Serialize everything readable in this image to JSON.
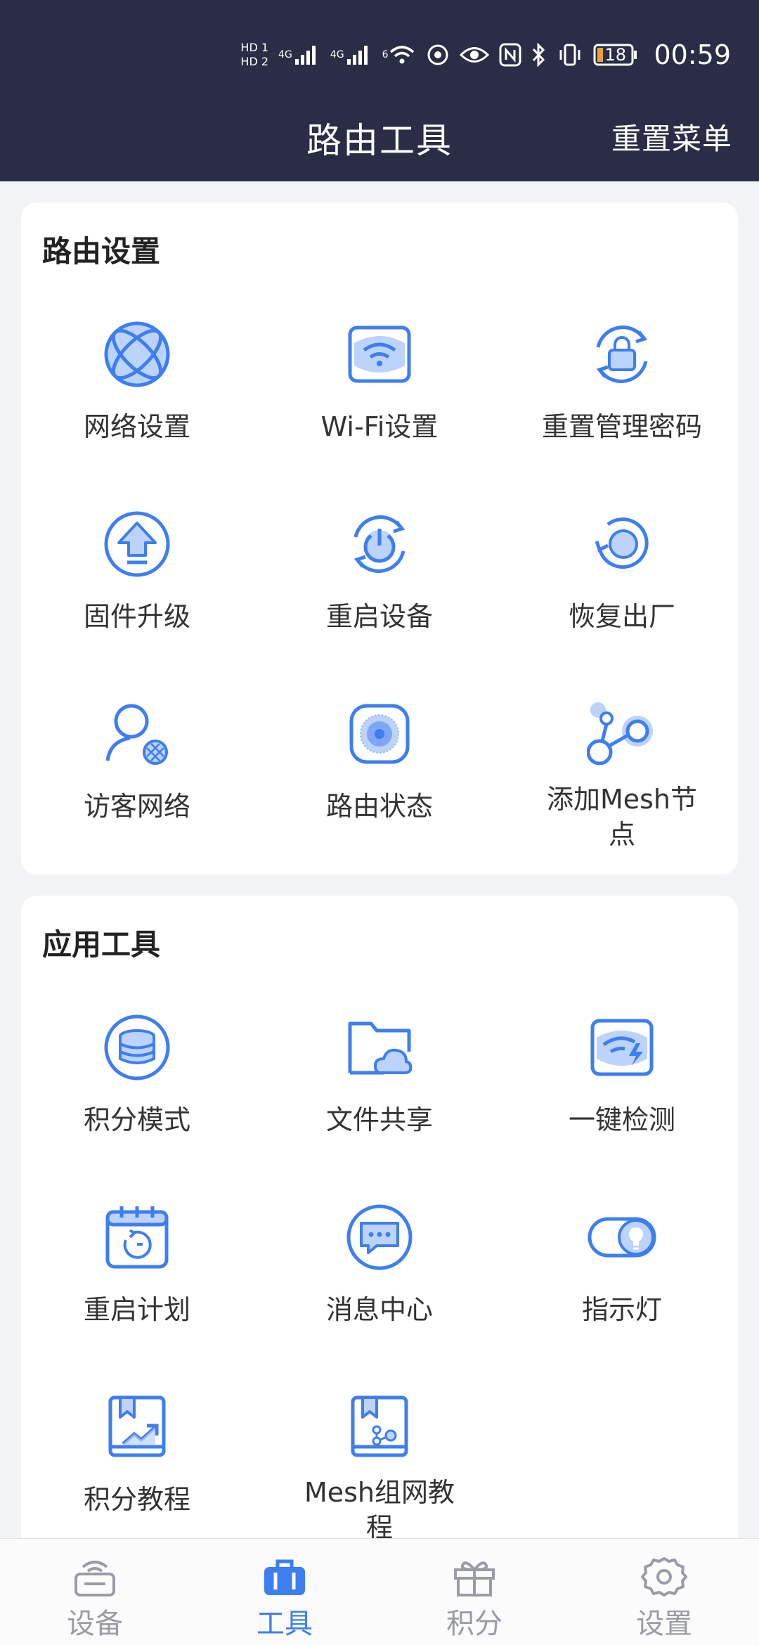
{
  "status_bar": {
    "time": "00:59",
    "battery": "18",
    "signal1": "4G",
    "signal2": "4G",
    "wifi": "6",
    "hd1": "HD 1",
    "hd2": "HD 2"
  },
  "header": {
    "title": "路由工具",
    "reset_menu": "重置菜单"
  },
  "router_section": {
    "title": "路由设置",
    "items": [
      {
        "label": "网络设置",
        "icon": "globe-icon"
      },
      {
        "label": "Wi-Fi设置",
        "icon": "wifi-icon"
      },
      {
        "label": "重置管理密码",
        "icon": "lock-reset-icon"
      },
      {
        "label": "固件升级",
        "icon": "upload-icon"
      },
      {
        "label": "重启设备",
        "icon": "power-icon"
      },
      {
        "label": "恢复出厂",
        "icon": "restore-icon"
      },
      {
        "label": "访客网络",
        "icon": "guest-icon"
      },
      {
        "label": "路由状态",
        "icon": "router-status-icon"
      },
      {
        "label": "添加Mesh节点",
        "icon": "mesh-node-icon"
      }
    ]
  },
  "app_section": {
    "title": "应用工具",
    "items": [
      {
        "label": "积分模式",
        "icon": "database-icon"
      },
      {
        "label": "文件共享",
        "icon": "folder-cloud-icon"
      },
      {
        "label": "一键检测",
        "icon": "wifi-check-icon"
      },
      {
        "label": "重启计划",
        "icon": "calendar-icon"
      },
      {
        "label": "消息中心",
        "icon": "message-icon"
      },
      {
        "label": "指示灯",
        "icon": "light-toggle-icon"
      },
      {
        "label": "积分教程",
        "icon": "book-chart-icon"
      },
      {
        "label": "Mesh组网教程",
        "icon": "book-mesh-icon"
      }
    ]
  },
  "bottom_nav": [
    {
      "label": "设备",
      "icon": "router-icon",
      "active": false
    },
    {
      "label": "工具",
      "icon": "toolbox-icon",
      "active": true
    },
    {
      "label": "积分",
      "icon": "gift-icon",
      "active": false
    },
    {
      "label": "设置",
      "icon": "gear-icon",
      "active": false
    }
  ],
  "colors": {
    "header_bg": "#2a2d45",
    "accent": "#3d7ef0",
    "icon_fill": "#bcd3fb",
    "nav_inactive": "#9a9ca5"
  }
}
